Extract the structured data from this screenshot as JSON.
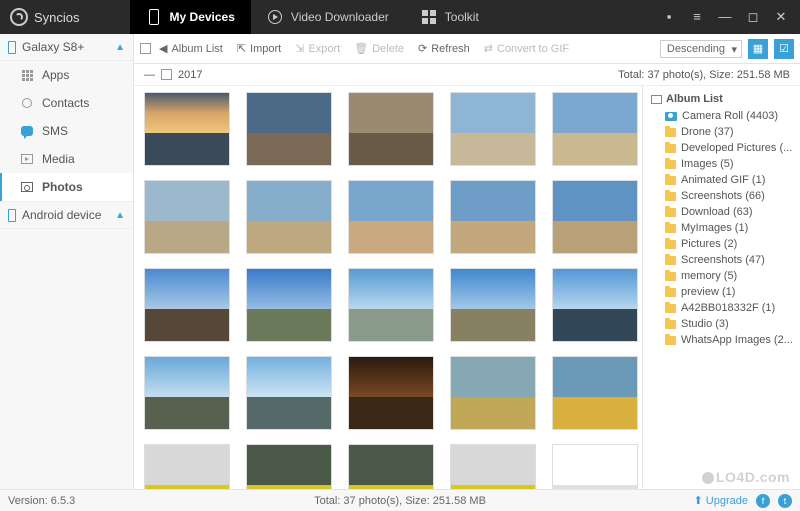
{
  "app": {
    "name": "Syncios"
  },
  "tabs": {
    "devices": "My Devices",
    "video": "Video Downloader",
    "toolkit": "Toolkit"
  },
  "sidebar": {
    "device1": "Galaxy S8+",
    "device2": "Android device",
    "items": {
      "apps": "Apps",
      "contacts": "Contacts",
      "sms": "SMS",
      "media": "Media",
      "photos": "Photos"
    }
  },
  "toolbar": {
    "albumlist": "Album List",
    "import": "Import",
    "export": "Export",
    "delete": "Delete",
    "refresh": "Refresh",
    "gif": "Convert to GIF",
    "sort": "Descending"
  },
  "subheader": {
    "year": "2017",
    "total": "Total: 37 photo(s), Size: 251.58 MB"
  },
  "albums": {
    "head": "Album List",
    "items": [
      "Camera Roll (4403)",
      "Drone (37)",
      "Developed Pictures (...",
      "Images (5)",
      "Animated GIF (1)",
      "Screenshots (66)",
      "Download (63)",
      "MyImages (1)",
      "Pictures (2)",
      "Screenshots (47)",
      "memory (5)",
      "preview (1)",
      "A42BB018332F (1)",
      "Studio (3)",
      "WhatsApp Images (2..."
    ]
  },
  "status": {
    "version": "Version: 6.5.3",
    "total": "Total: 37 photo(s), Size: 251.58 MB",
    "upgrade": "Upgrade"
  },
  "watermark": "LO4D.com",
  "thumbs": [
    {
      "sky": "linear-gradient(#4a5b6e,#d7a46b,#f0c77a)",
      "ground": "#3a4a58"
    },
    {
      "sky": "#4a6a88",
      "ground": "#7a6a55"
    },
    {
      "sky": "#9a8a72",
      "ground": "#6a5a48"
    },
    {
      "sky": "#8fb5d4",
      "ground": "#c8b89a"
    },
    {
      "sky": "#7aa8d0",
      "ground": "#cab890"
    },
    {
      "sky": "#9bb8cc",
      "ground": "#b8a886"
    },
    {
      "sky": "#86adc9",
      "ground": "#bda882"
    },
    {
      "sky": "#78a6cc",
      "ground": "#caa880"
    },
    {
      "sky": "#6e9ec7",
      "ground": "#c3a87e"
    },
    {
      "sky": "#5f93c4",
      "ground": "#b8a078"
    },
    {
      "sky": "linear-gradient(#4a8ad0,#a8c8e6)",
      "ground": "#564838"
    },
    {
      "sky": "linear-gradient(#3a7ac8,#95bde4)",
      "ground": "#6a7a5a"
    },
    {
      "sky": "linear-gradient(#569ad4,#bad8ee)",
      "ground": "#8a9a88"
    },
    {
      "sky": "linear-gradient(#4088cf,#a2c8e8)",
      "ground": "#888062"
    },
    {
      "sky": "linear-gradient(#5498d6,#b6d6ee)",
      "ground": "#324858"
    },
    {
      "sky": "linear-gradient(#6aa8da,#c4deee)",
      "ground": "#586050"
    },
    {
      "sky": "linear-gradient(#74b0de,#cde4f2)",
      "ground": "#556a68"
    },
    {
      "sky": "linear-gradient(#2a1a12,#7a4820)",
      "ground": "#3a2816"
    },
    {
      "sky": "#86a8b4",
      "ground": "#c0a858"
    },
    {
      "sky": "#6a9ab8",
      "ground": "#d8b040"
    },
    {
      "sky": "#d8d8d8",
      "ground": "#d8c820"
    },
    {
      "sky": "#4a5848",
      "ground": "#d4c428"
    },
    {
      "sky": "#4a5848",
      "ground": "#d4c428"
    },
    {
      "sky": "#d8d8d8",
      "ground": "#d8c820"
    },
    {
      "sky": "#ffffff",
      "ground": "#e0e0e0"
    }
  ]
}
